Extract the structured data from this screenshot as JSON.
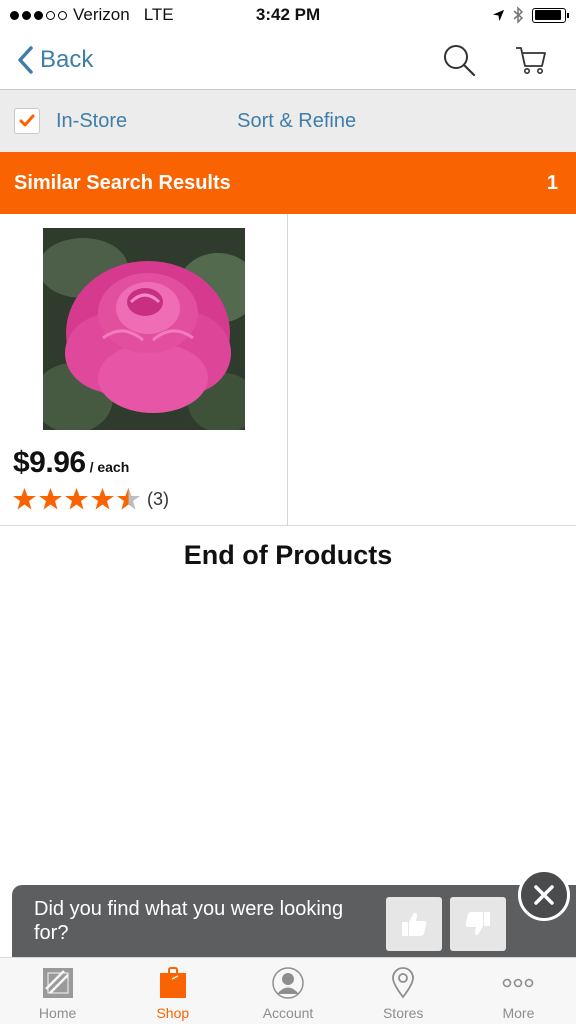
{
  "status_bar": {
    "carrier": "Verizon",
    "network": "LTE",
    "time": "3:42 PM",
    "signal_filled": 3,
    "signal_total": 5,
    "battery_level": 0.9
  },
  "nav": {
    "back_label": "Back",
    "icons": [
      "search-icon",
      "cart-icon"
    ]
  },
  "filters": {
    "in_store_label": "In-Store",
    "in_store_checked": true,
    "sort_refine_label": "Sort & Refine"
  },
  "results_header": {
    "title": "Similar Search Results",
    "count": "1"
  },
  "products": [
    {
      "price": "$9.96",
      "unit": "/ each",
      "rating": 4.5,
      "review_count": "(3)"
    }
  ],
  "end_label": "End of Products",
  "feedback": {
    "question": "Did you find what you were looking for?"
  },
  "tabs": [
    {
      "label": "Home",
      "icon": "home-depot-logo-icon"
    },
    {
      "label": "Shop",
      "icon": "shop-bag-icon",
      "active": true
    },
    {
      "label": "Account",
      "icon": "account-icon"
    },
    {
      "label": "Stores",
      "icon": "location-pin-icon"
    },
    {
      "label": "More",
      "icon": "more-icon"
    }
  ],
  "colors": {
    "brand_orange": "#f96302",
    "link_blue": "#3f7ea8",
    "feedback_gray": "#5d5e60"
  }
}
